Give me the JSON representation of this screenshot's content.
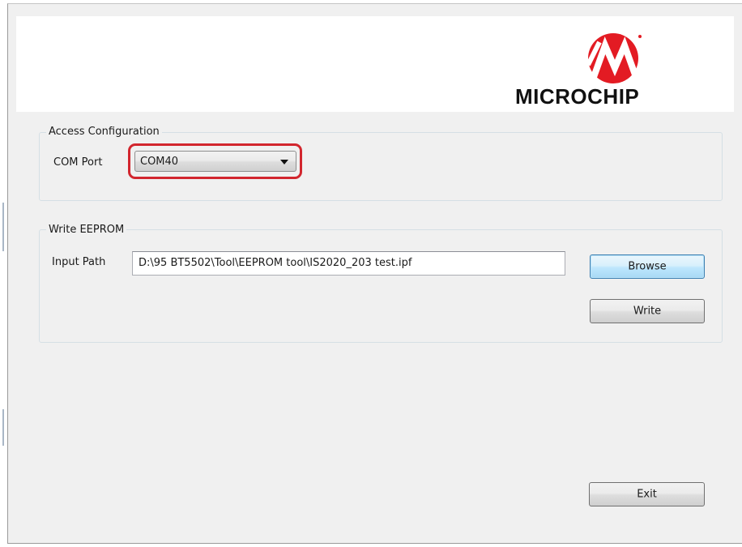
{
  "brand": {
    "name": "MICROCHIP",
    "color": "#e31b23"
  },
  "access_config": {
    "title": "Access Configuration",
    "com_port_label": "COM Port",
    "com_port_value": "COM40"
  },
  "write_eeprom": {
    "title": "Write EEPROM",
    "input_path_label": "Input Path",
    "input_path_value": "D:\\95 BT5502\\Tool\\EEPROM tool\\IS2020_203 test.ipf",
    "browse_label": "Browse",
    "write_label": "Write"
  },
  "footer": {
    "exit_label": "Exit"
  },
  "annotation": {
    "highlight_color": "#d2262e"
  }
}
